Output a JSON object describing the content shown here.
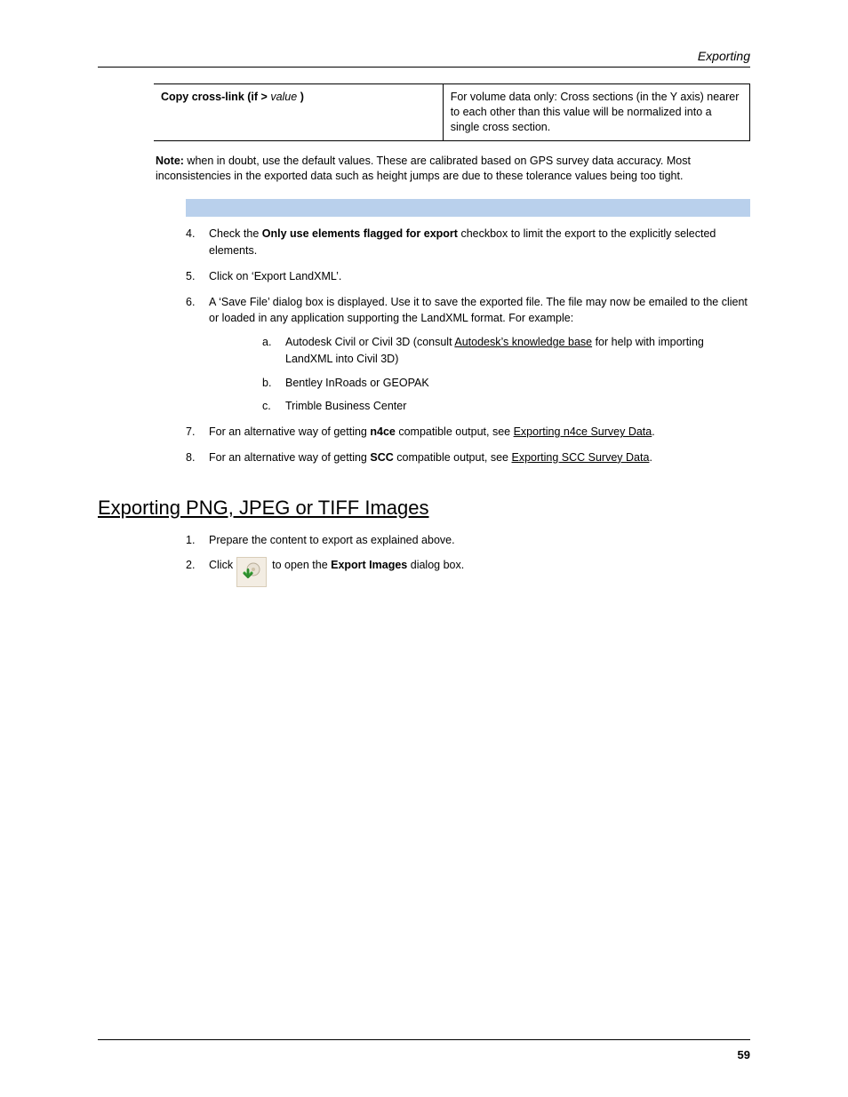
{
  "header": {
    "running": "Exporting"
  },
  "table": {
    "row": {
      "left_label": "Copy cross-link (if >",
      "left_value_hint": "value",
      "left_tail": ")",
      "right": "For volume data only: Cross sections (in the Y axis) nearer to each other than this value will be normalized into a single cross section."
    }
  },
  "note": {
    "label": "Note:",
    "text": " when in doubt, use the default values. These are calibrated based on GPS survey data accuracy. Most inconsistencies in the exported data such as height jumps are due to these tolerance values being too tight."
  },
  "steps": {
    "s4": {
      "intro": "Check the ",
      "bold": "Only use elements flagged for export",
      "tail": " checkbox to limit the export to the explicitly selected elements."
    },
    "s5": "Click on ‘Export LandXML’.",
    "s6": {
      "text": "A ‘Save File’ dialog box is displayed. Use it to save the exported file. The file may now be emailed to the client or loaded in any application supporting the LandXML format. For example:",
      "a": {
        "pre": "Autodesk Civil or Civil 3D (consult ",
        "link": "Autodesk’s knowledge base",
        "post": " for help with importing LandXML into Civil 3D)"
      },
      "b": "Bentley InRoads or GEOPAK",
      "c": "Trimble Business Center"
    },
    "s7": {
      "pre": "For an alternative way of getting ",
      "mid1": "n4ce",
      "mid2": " compatible output, see ",
      "link": "Exporting n4ce Survey Data",
      "post": "."
    },
    "s8": {
      "pre": "For an alternative way of getting ",
      "mid1": "SCC",
      "mid2": " compatible output, see ",
      "link": "Exporting SCC Survey Data",
      "post": "."
    }
  },
  "section2": {
    "title": "Exporting PNG, JPEG or TIFF Images",
    "s1": "Prepare the content to export as explained above.",
    "s2": {
      "pre": "Click ",
      "post1": " to open the ",
      "bold": "Export Images",
      "post2": " dialog box."
    }
  },
  "icons": {
    "export": "export-icon"
  },
  "footer": {
    "page": "59"
  }
}
